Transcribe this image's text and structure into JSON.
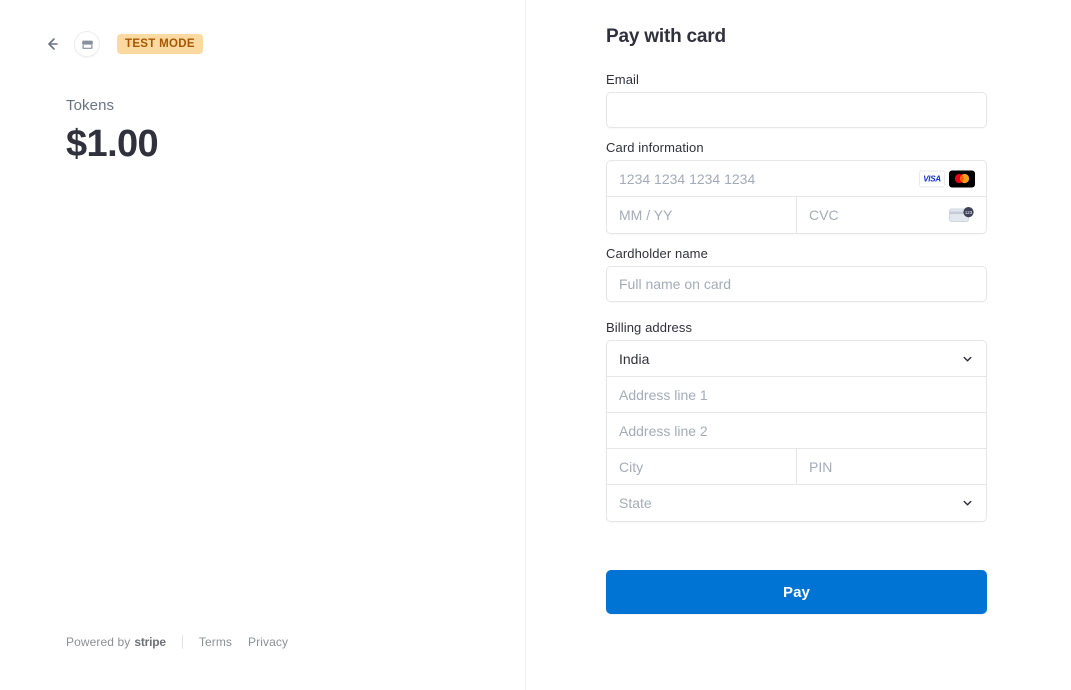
{
  "header": {
    "back_icon": "arrow-left-icon",
    "merchant_icon": "store-icon",
    "test_mode_badge": "TEST MODE"
  },
  "summary": {
    "product_name": "Tokens",
    "amount": "$1.00"
  },
  "footer": {
    "powered_by_prefix": "Powered by",
    "powered_by_brand": "stripe",
    "terms_label": "Terms",
    "privacy_label": "Privacy"
  },
  "form": {
    "title": "Pay with card",
    "email": {
      "label": "Email",
      "value": "",
      "placeholder": ""
    },
    "card": {
      "label": "Card information",
      "number_placeholder": "1234 1234 1234 1234",
      "number_value": "",
      "expiry_placeholder": "MM / YY",
      "expiry_value": "",
      "cvc_placeholder": "CVC",
      "cvc_value": "",
      "brands": [
        "visa-icon",
        "mastercard-icon"
      ],
      "cvc_hint_icon": "cvc-card-icon",
      "visa_label": "VISA"
    },
    "cardholder": {
      "label": "Cardholder name",
      "placeholder": "Full name on card",
      "value": ""
    },
    "billing": {
      "label": "Billing address",
      "country_value": "India",
      "address1_placeholder": "Address line 1",
      "address1_value": "",
      "address2_placeholder": "Address line 2",
      "address2_value": "",
      "city_placeholder": "City",
      "city_value": "",
      "postal_placeholder": "PIN",
      "postal_value": "",
      "state_placeholder": "State",
      "state_value": "",
      "chevron_icon": "chevron-down-icon"
    },
    "submit_label": "Pay"
  },
  "colors": {
    "accent": "#0074d4",
    "test_badge_bg": "#fcd9a0",
    "test_badge_text": "#a75700",
    "text_primary": "#30313d",
    "text_muted": "#6a7383",
    "placeholder": "#a3acb9",
    "border": "#e6e6e6"
  }
}
